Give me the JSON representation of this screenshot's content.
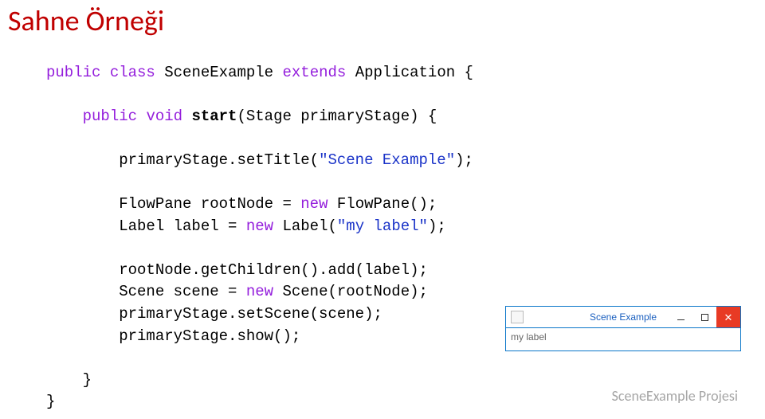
{
  "title": "Sahne Örneği",
  "code": {
    "kw_public1": "public",
    "kw_class": "class",
    "typeName": "SceneExample",
    "kw_extends": "extends",
    "baseType": "Application",
    "brace_open": "{",
    "kw_public2": "public",
    "kw_void": "void",
    "method_start": "start",
    "param_sig": "(Stage primaryStage) {",
    "setTitle_obj": "primaryStage.setTitle(",
    "setTitle_str": "\"Scene Example\"",
    "setTitle_end": ");",
    "decl_flow_left": "FlowPane rootNode = ",
    "kw_new1": "new",
    "decl_flow_right": " FlowPane();",
    "decl_label_left": "Label label = ",
    "kw_new2": "new",
    "decl_label_mid": " Label(",
    "decl_label_str": "\"my label\"",
    "decl_label_end": ");",
    "addChild": "rootNode.getChildren().add(label);",
    "scene_left": "Scene scene = ",
    "kw_new3": "new",
    "scene_right": " Scene(rootNode);",
    "setScene": "primaryStage.setScene(scene);",
    "show": "primaryStage.show();",
    "brace_close_inner": "}",
    "brace_close_outer": "}"
  },
  "window": {
    "title": "Scene Example",
    "content": "my label",
    "minimize_glyph": "minimize",
    "maximize_glyph": "maximize",
    "close_glyph": "✕"
  },
  "footer": "SceneExample Projesi"
}
